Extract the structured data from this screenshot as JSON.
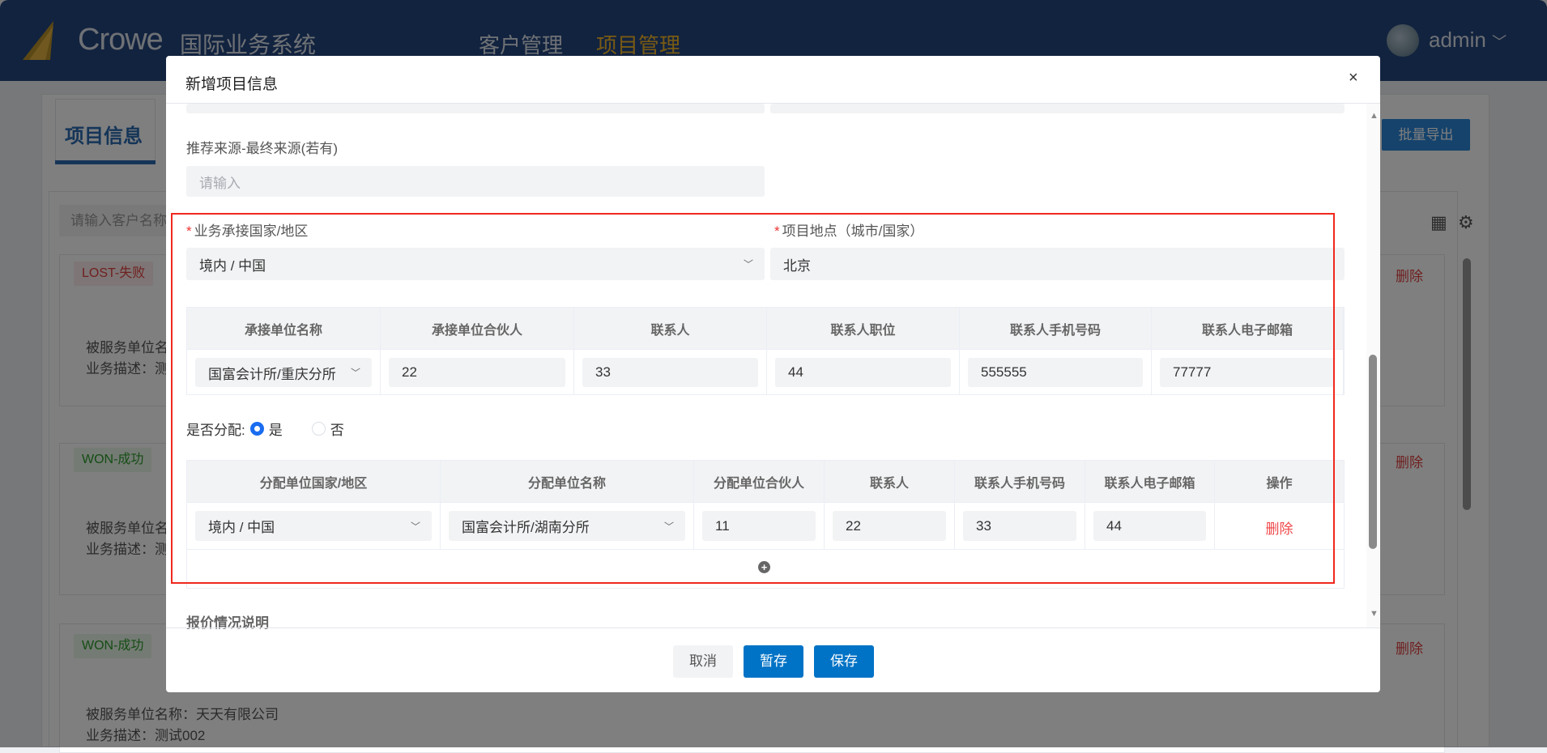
{
  "header": {
    "brand": "Crowe",
    "system_name": "国际业务系统",
    "nav": [
      "客户管理",
      "项目管理"
    ],
    "active_nav": "项目管理",
    "user": "admin"
  },
  "background": {
    "tab_title": "项目信息",
    "export_label": "批量导出",
    "search_placeholder": "请输入客户名称",
    "cards": [
      {
        "status": "LOST-失败",
        "delete": "删除",
        "client_label": "被服务单位名",
        "desc_label": "业务描述：测"
      },
      {
        "status": "WON-成功",
        "delete": "删除",
        "client_label": "被服务单位名",
        "desc_label": "业务描述：测"
      },
      {
        "status": "WON-成功",
        "delete": "删除",
        "client_label": "被服务单位名称：天天有限公司",
        "desc_label": "业务描述：测试002"
      }
    ]
  },
  "modal": {
    "title": "新增项目信息",
    "close": "×",
    "referral_label": "推荐来源-最终来源(若有)",
    "referral_placeholder": "请输入",
    "country_label": "业务承接国家/地区",
    "country_value": "境内 / 中国",
    "location_label": "项目地点（城市/国家）",
    "location_value": "北京",
    "undertake_table": {
      "headers": [
        "承接单位名称",
        "承接单位合伙人",
        "联系人",
        "联系人职位",
        "联系人手机号码",
        "联系人电子邮箱"
      ],
      "row": [
        "国富会计所/重庆分所",
        "22",
        "33",
        "44",
        "555555",
        "77777"
      ]
    },
    "allocate_label": "是否分配:",
    "allocate_options": [
      "是",
      "否"
    ],
    "allocate_selected": "是",
    "allocate_table": {
      "headers": [
        "分配单位国家/地区",
        "分配单位名称",
        "分配单位合伙人",
        "联系人",
        "联系人手机号码",
        "联系人电子邮箱",
        "操作"
      ],
      "row": [
        "境内 / 中国",
        "国富会计所/湖南分所",
        "11",
        "22",
        "33",
        "44"
      ],
      "action": "删除"
    },
    "quote_label": "报价情况说明",
    "buttons": {
      "cancel": "取消",
      "draft": "暂存",
      "save": "保存"
    }
  },
  "colors": {
    "primary": "#0073c6",
    "danger": "#e04040",
    "highlight": "#f0281e"
  }
}
